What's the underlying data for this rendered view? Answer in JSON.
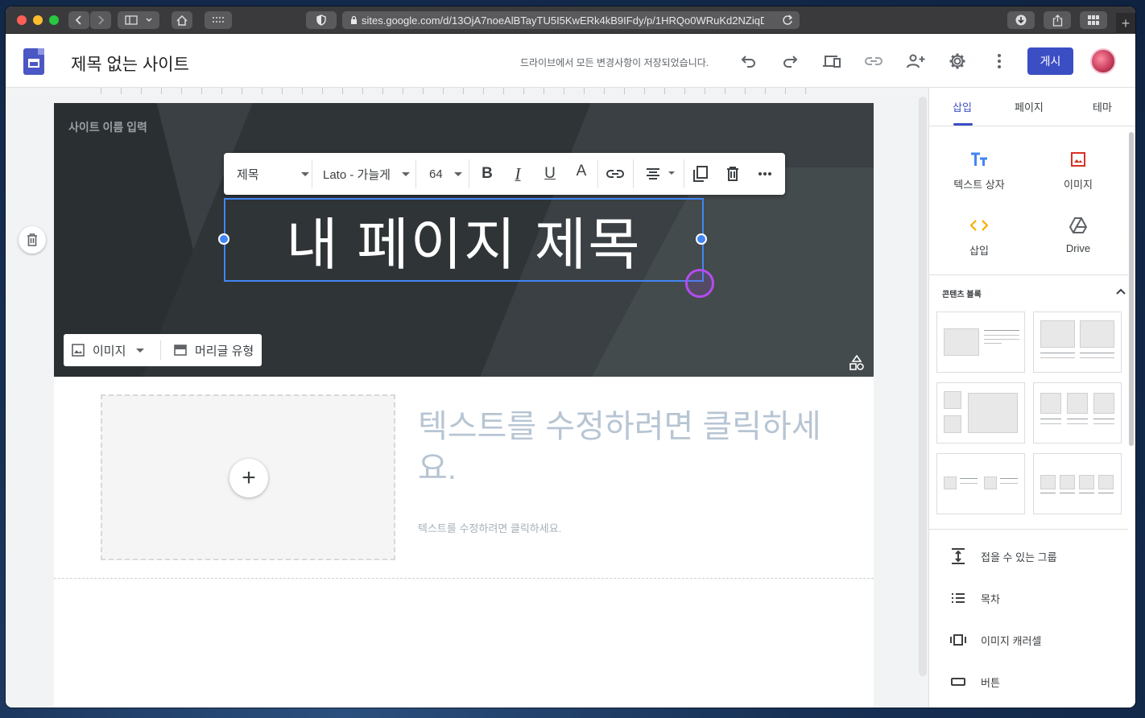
{
  "browser": {
    "url": "sites.google.com/d/13OjA7noeAlBTayTU5I5KwERk4kB9IFdy/p/1HRQo0WRuKd2NZiqDJc"
  },
  "header": {
    "site_title": "제목 없는 사이트",
    "save_status": "드라이브에서 모든 변경사항이 저장되었습니다.",
    "publish_label": "게시"
  },
  "hero": {
    "site_name_placeholder": "사이트 이름 입력",
    "title": "내 페이지 제목",
    "toolbar": {
      "style": "제목",
      "font": "Lato - 가늘게",
      "size": "64"
    },
    "tools": {
      "image_label": "이미지",
      "header_type_label": "머리글 유형"
    }
  },
  "content": {
    "heading_placeholder": "텍스트를 수정하려면 클릭하세요.",
    "body_placeholder": "텍스트를 수정하려면 클릭하세요."
  },
  "panel": {
    "tabs": [
      "삽입",
      "페이지",
      "테마"
    ],
    "insert_items": {
      "text_box": "텍스트 상자",
      "image": "이미지",
      "embed": "삽입",
      "drive": "Drive"
    },
    "blocks_label": "콘텐츠 블록",
    "list_items": [
      "접을 수 있는 그룹",
      "목차",
      "이미지 캐러셀",
      "버튼"
    ]
  },
  "colors": {
    "accent": "#3b4ec4",
    "selection": "#4285f4",
    "text_box_icon": "#4285f4",
    "image_icon": "#d93025",
    "embed_icon": "#f9ab00"
  }
}
